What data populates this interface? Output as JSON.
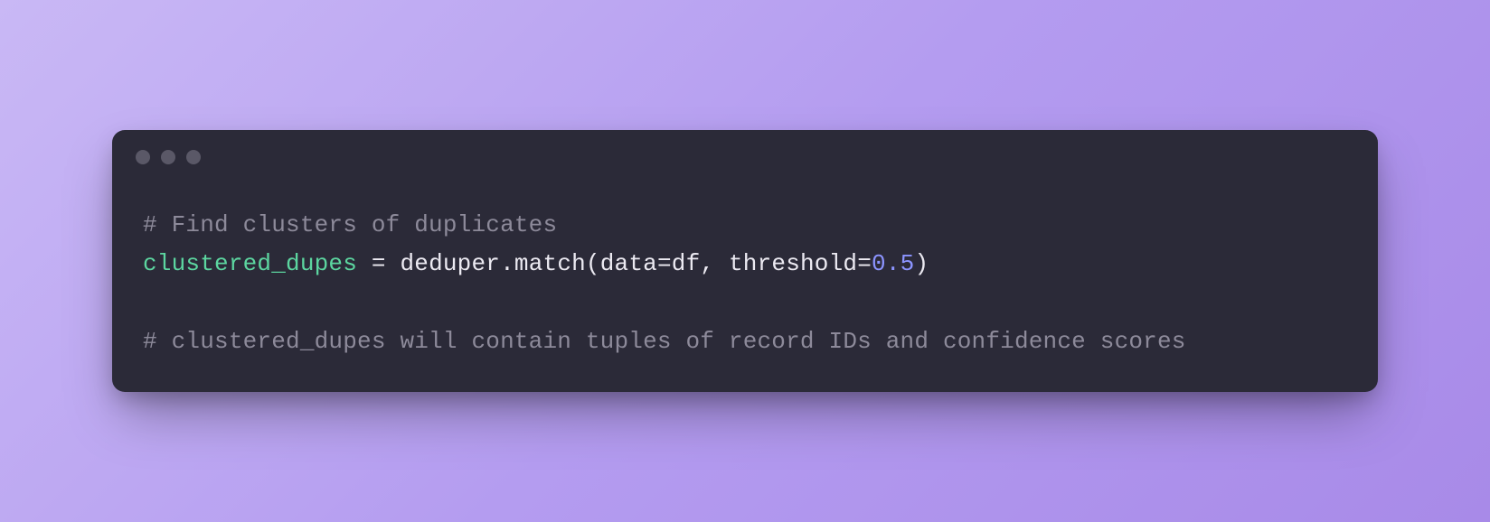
{
  "code": {
    "line1_comment": "# Find clusters of duplicates",
    "line2": {
      "var": "clustered_dupes",
      "eq": " = ",
      "obj": "deduper",
      "dot": ".",
      "method": "match",
      "open": "(",
      "arg1_key": "data",
      "arg1_eq": "=",
      "arg1_val": "df",
      "sep": ", ",
      "arg2_key": "threshold",
      "arg2_eq": "=",
      "arg2_val": "0.5",
      "close": ")"
    },
    "line4_comment": "# clustered_dupes will contain tuples of record IDs and confidence scores"
  }
}
